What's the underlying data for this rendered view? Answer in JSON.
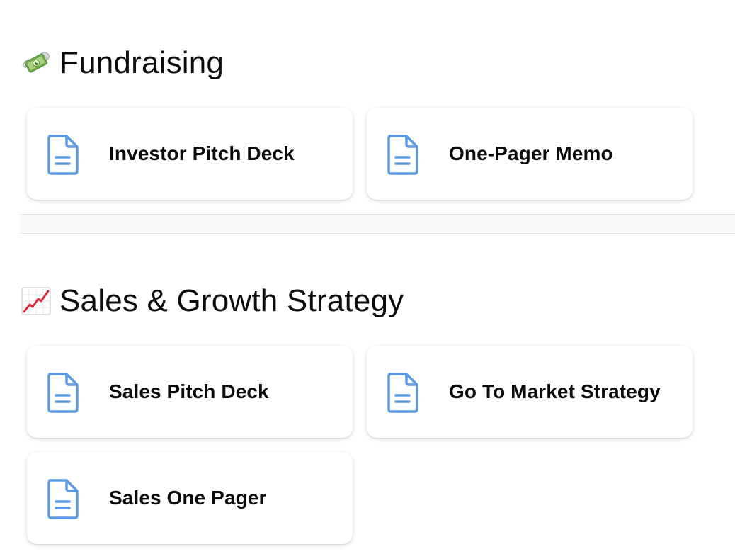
{
  "sections": [
    {
      "icon": "money-with-wings-icon",
      "title": "Fundraising",
      "cards": [
        {
          "label": "Investor Pitch Deck",
          "icon": "document-icon"
        },
        {
          "label": "One-Pager Memo",
          "icon": "document-icon"
        }
      ]
    },
    {
      "icon": "chart-increasing-icon",
      "title": "Sales & Growth Strategy",
      "cards": [
        {
          "label": "Sales Pitch Deck",
          "icon": "document-icon"
        },
        {
          "label": "Go To Market Strategy",
          "icon": "document-icon"
        },
        {
          "label": "Sales One Pager",
          "icon": "document-icon"
        }
      ]
    }
  ],
  "colors": {
    "document_icon": "#5b9be3",
    "card_background": "#ffffff",
    "divider_band": "#f9f9f9",
    "text": "#0b0b0b"
  }
}
